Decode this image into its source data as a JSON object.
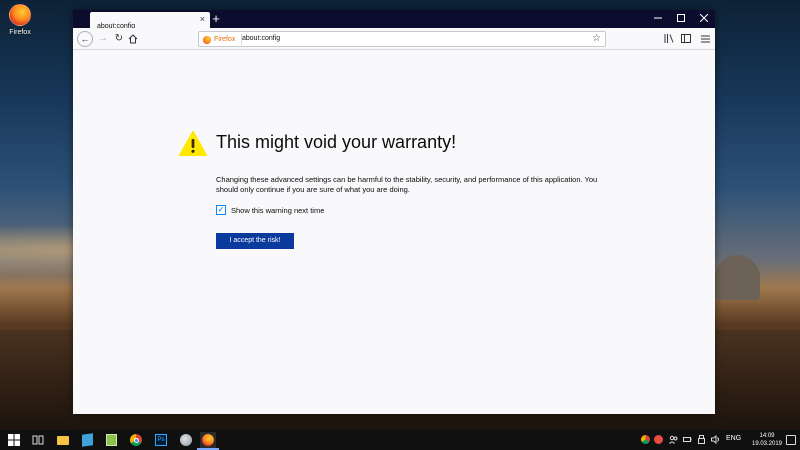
{
  "desktop": {
    "icon_label": "Firefox"
  },
  "browser": {
    "tab_title": "about:config",
    "tab_close": "×",
    "new_tab": "+",
    "url_identity": "Firefox",
    "url": "about:config"
  },
  "content": {
    "title": "This might void your warranty!",
    "body": "Changing these advanced settings can be harmful to the stability, security, and performance of this application. You should only continue if you are sure of what you are doing.",
    "checkbox_label": "Show this warning next time",
    "checkbox_checked": true,
    "accept_button": "I accept the risk!"
  },
  "taskbar": {
    "language": "ENG",
    "time": "14:09",
    "date": "19.03.2019"
  },
  "colors": {
    "accept_button": "#0a3a9c",
    "titlebar": "#0c0c2e",
    "warning": "#ffe900"
  }
}
